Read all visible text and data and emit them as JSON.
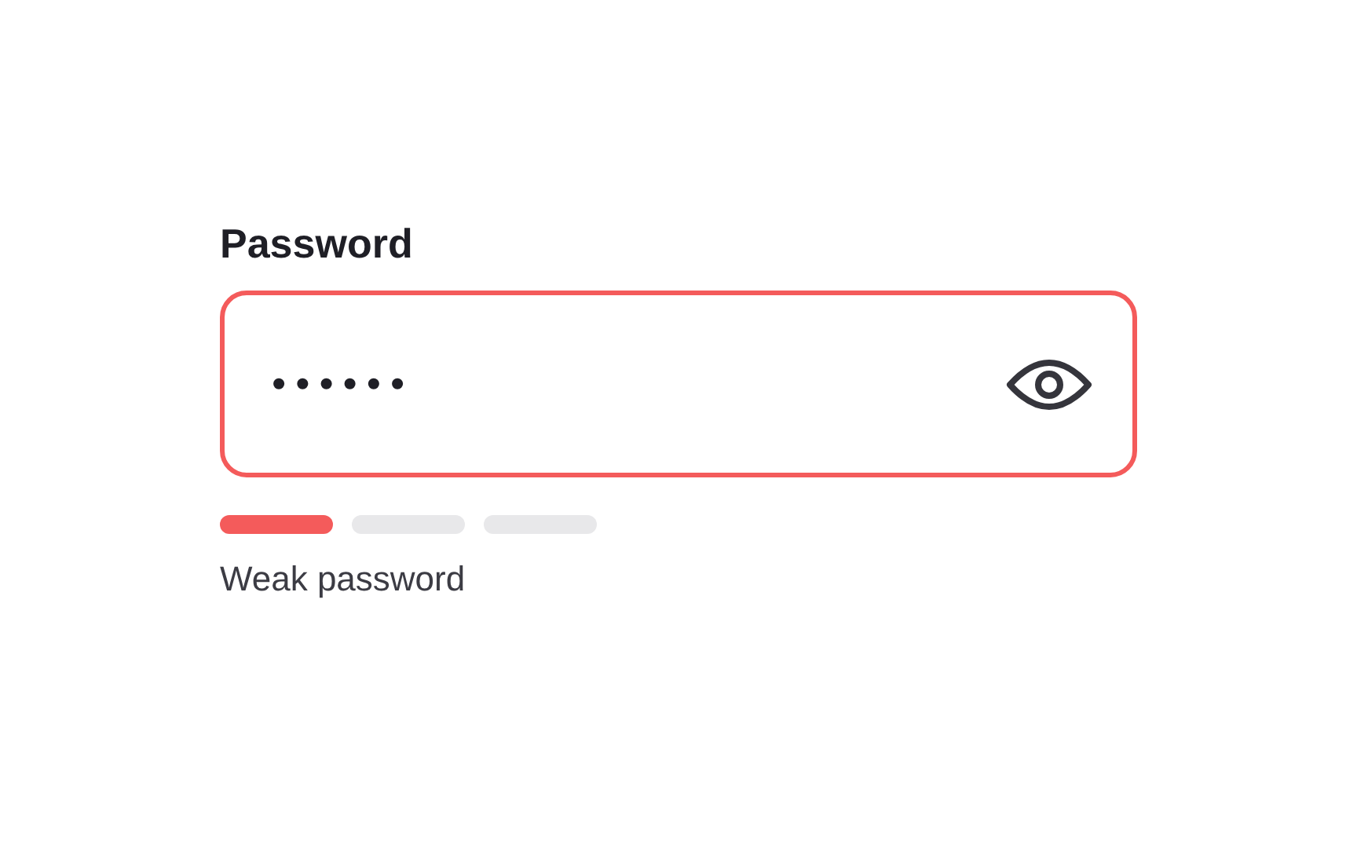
{
  "password": {
    "label": "Password",
    "value": "••••••",
    "invalid": true
  },
  "strength": {
    "segments": [
      {
        "filled": true
      },
      {
        "filled": false
      },
      {
        "filled": false
      }
    ],
    "label": "Weak password"
  }
}
